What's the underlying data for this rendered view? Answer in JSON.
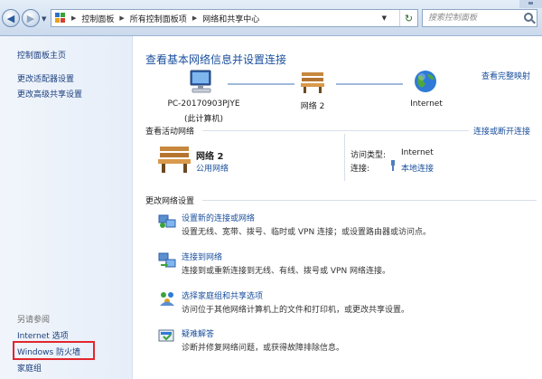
{
  "address_bar": {
    "breadcrumbs": [
      "控制面板",
      "所有控制面板项",
      "网络和共享中心"
    ],
    "search_placeholder": "搜索控制面板"
  },
  "left_panel": {
    "links": [
      "控制面板主页",
      "更改适配器设置",
      "更改高级共享设置"
    ],
    "see_also_label": "另请参阅",
    "see_also_links": [
      "Internet 选项",
      "Windows 防火墙",
      "家庭组"
    ]
  },
  "main": {
    "title": "查看基本网络信息并设置连接",
    "full_map_link": "查看完整映射",
    "network_map": {
      "computer_name": "PC-20170903PJYE",
      "computer_sub": "(此计算机)",
      "network_label": "网络  2",
      "internet_label": "Internet"
    },
    "active_networks_label": "查看活动网络",
    "connect_disconnect_link": "连接或断开连接",
    "active_network": {
      "name": "网络  2",
      "type": "公用网络",
      "access_type_label": "访问类型:",
      "access_type_value": "Internet",
      "connections_label": "连接:",
      "connection_value": "本地连接"
    },
    "change_settings_label": "更改网络设置",
    "tasks": [
      {
        "link": "设置新的连接或网络",
        "desc": "设置无线、宽带、拨号、临时或 VPN 连接；或设置路由器或访问点。",
        "icon": "new-connection-icon"
      },
      {
        "link": "连接到网络",
        "desc": "连接到或重新连接到无线、有线、拨号或 VPN 网络连接。",
        "icon": "connect-network-icon"
      },
      {
        "link": "选择家庭组和共享选项",
        "desc": "访问位于其他网络计算机上的文件和打印机，或更改共享设置。",
        "icon": "homegroup-icon"
      },
      {
        "link": "疑难解答",
        "desc": "诊断并修复网络问题，或获得故障排除信息。",
        "icon": "troubleshoot-icon"
      }
    ]
  },
  "colors": {
    "link": "#1a4f9c",
    "highlight_box": "#e2262d"
  }
}
